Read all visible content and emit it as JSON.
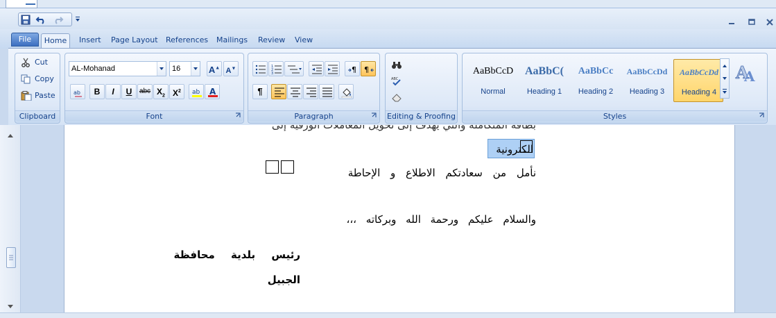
{
  "quick_access": {
    "save_icon": "save-icon",
    "undo_icon": "undo-icon",
    "redo_icon": "redo-icon"
  },
  "tabs": {
    "file": "File",
    "home": "Home",
    "insert": "Insert",
    "page_layout": "Page Layout",
    "references": "References",
    "mailings": "Mailings",
    "review": "Review",
    "view": "View"
  },
  "clipboard": {
    "cut": "Cut",
    "copy": "Copy",
    "paste": "Paste",
    "label": "Clipboard"
  },
  "font": {
    "name": "AL-Mohanad",
    "size": "16",
    "label": "Font"
  },
  "paragraph": {
    "label": "Paragraph"
  },
  "editing": {
    "label": "Editing & Proofing"
  },
  "styles": {
    "label": "Styles",
    "items": [
      {
        "preview": "AaBbCcD",
        "label": "Normal"
      },
      {
        "preview": "AaBbC(",
        "label": "Heading 1"
      },
      {
        "preview": "AaBbCc",
        "label": "Heading 2"
      },
      {
        "preview": "AaBbCcDd",
        "label": "Heading 3"
      },
      {
        "preview": "AaBbCcDd",
        "label": "Heading 4",
        "selected": true
      }
    ]
  },
  "document": {
    "line_top": "بطاقة المتكاملة والتي يهدف إلى تحويل المعاملات الورقية إلى",
    "line_electronic": "الكترونية",
    "line_awaiting": "نأمل من سعادتكم الاطلاع و الإحاطة",
    "line_salam": "والسلام عليكم ورحمة الله وبركاته ،،،",
    "line_head1": "رئيس بلدية محافظة",
    "line_head2": "الجبيل"
  },
  "colors": {
    "ribbon_text": "#15428b",
    "selected_style": "#ffd56b",
    "selection": "#aed0f5"
  }
}
